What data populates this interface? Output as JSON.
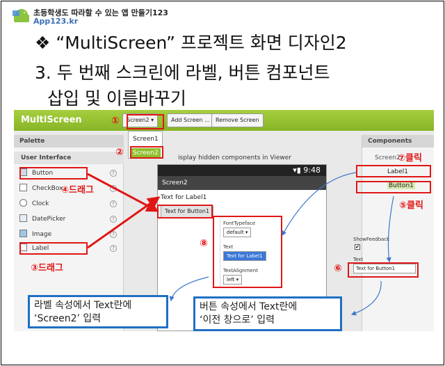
{
  "header": {
    "title": "초등학생도 따라할 수 있는 앱 만들기123",
    "url": "App123.kr",
    "line1": "❖ “MultiScreen” 프로젝트 화면 디자인2",
    "line2": "3. 두 번째 스크린에 라벨, 버튼 컴포넌트",
    "line3": "삽입 및 이름바꾸기"
  },
  "app": {
    "name": "MultiScreen",
    "screen_selector": "Screen2 ▾",
    "add_screen": "Add Screen ...",
    "remove_screen": "Remove Screen",
    "dropdown": [
      "Screen1",
      "Screen2"
    ]
  },
  "palette": {
    "title": "Palette",
    "section": "User Interface",
    "items": [
      "Button",
      "CheckBox",
      "Clock",
      "DatePicker",
      "Image",
      "Label"
    ]
  },
  "viewer": {
    "checkbox_text": "isplay hidden components in Viewer",
    "time": "9:48",
    "screen_title": "Screen2",
    "label_text": "Text for Label1",
    "button_text": "Text for Button1"
  },
  "components": {
    "title": "Components",
    "root": "Screen2",
    "items": [
      "Label1",
      "Button1"
    ]
  },
  "props_label": {
    "font_typeface_label": "FontTypeface",
    "font_typeface_value": "default ▾",
    "text_label": "Text",
    "text_value": "Text for Label1",
    "align_label": "TextAlignment",
    "align_value": "left ▾"
  },
  "props_button": {
    "show_feedback_label": "ShowFeedback",
    "show_feedback_mark": "✔",
    "text_label": "Text",
    "text_value": "Text for Button1"
  },
  "annotations": {
    "n1": "①",
    "n2": "②",
    "n3": "③드래그",
    "n4": "④드래그",
    "n5": "⑤클릭",
    "n6": "⑥",
    "n7": "⑦클릭",
    "n8": "⑧"
  },
  "callouts": {
    "left_line1": "라벨 속성에서 Text란에",
    "left_line2": "‘Screen2’ 입력",
    "right_line1": "버튼 속성에서 Text란에",
    "right_line2": "‘이전 창으로’ 입력"
  },
  "colors": {
    "accent_green": "#8fbf2d",
    "annotation_red": "#e01616",
    "callout_blue": "#1f6fc4"
  }
}
